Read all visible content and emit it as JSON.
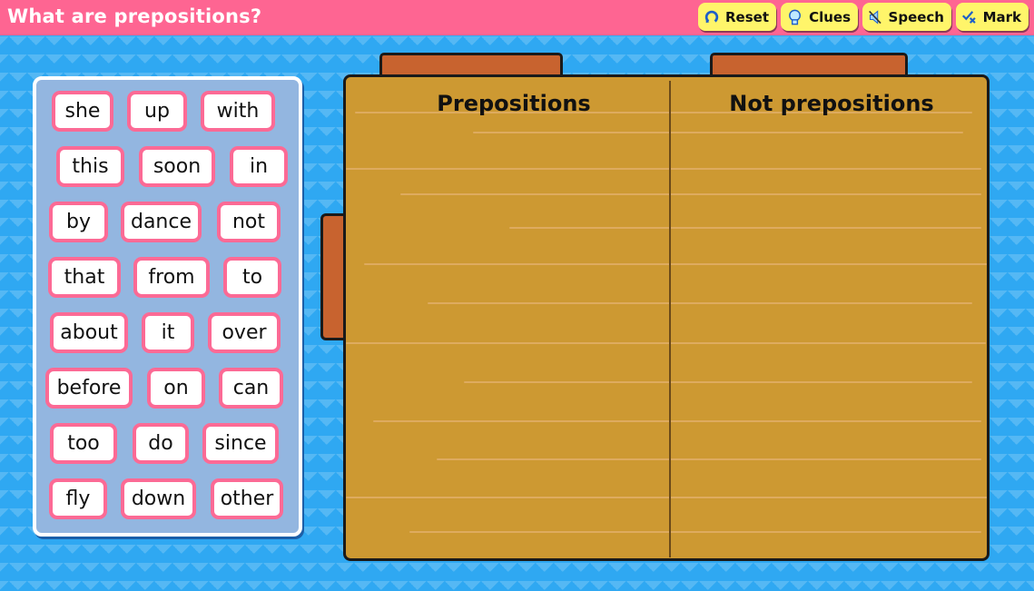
{
  "header": {
    "title": "What are prepositions?",
    "buttons": [
      {
        "label": "Reset",
        "icon": "reset-icon"
      },
      {
        "label": "Clues",
        "icon": "lightbulb-icon"
      },
      {
        "label": "Speech",
        "icon": "speaker-muted-icon"
      },
      {
        "label": "Mark",
        "icon": "check-cross-icon"
      }
    ]
  },
  "word_bank": {
    "words": [
      "she",
      "up",
      "with",
      "this",
      "soon",
      "in",
      "by",
      "dance",
      "not",
      "that",
      "from",
      "to",
      "about",
      "it",
      "over",
      "before",
      "on",
      "can",
      "too",
      "do",
      "since",
      "fly",
      "down",
      "other"
    ]
  },
  "board": {
    "columns": [
      {
        "heading": "Prepositions"
      },
      {
        "heading": "Not prepositions"
      }
    ]
  },
  "colors": {
    "header_bg": "#fe6592",
    "button_bg": "#fff56a",
    "background": "#2fa8f2",
    "tile_border": "#fc6a95",
    "board": "#cd9932",
    "board_tab": "#c8632f"
  }
}
